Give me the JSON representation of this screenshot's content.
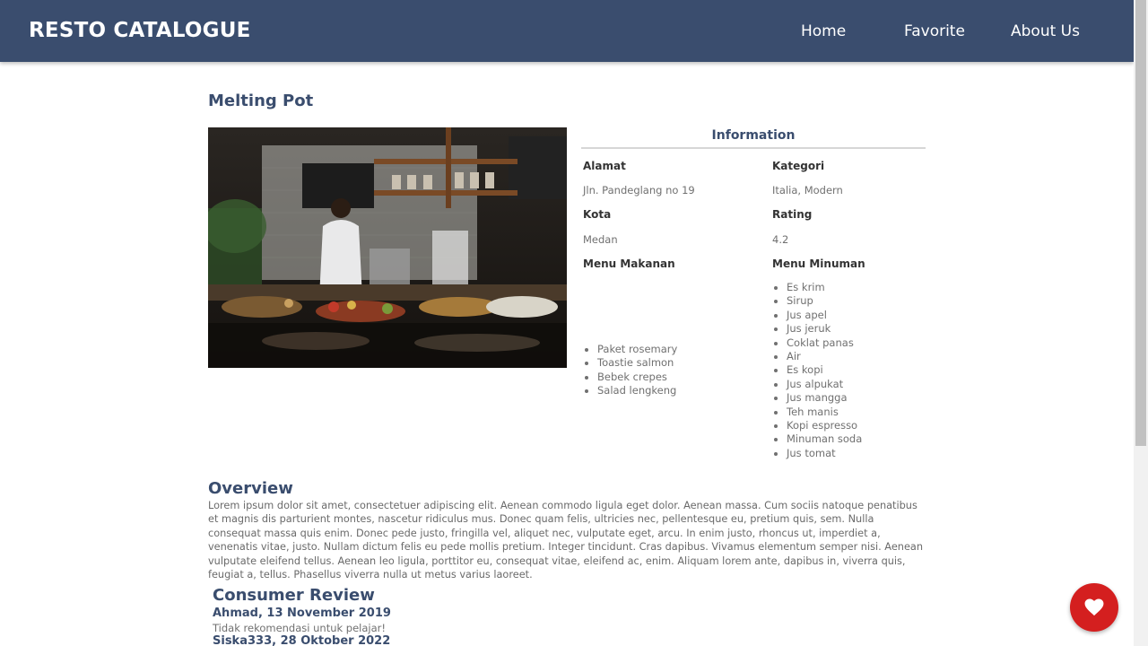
{
  "header": {
    "brand": "RESTO CATALOGUE",
    "nav": [
      "Home",
      "Favorite",
      "About Us"
    ]
  },
  "restaurant": {
    "name": "Melting Pot",
    "info_heading": "Information",
    "alamat_label": "Alamat",
    "alamat": "Jln. Pandeglang no 19",
    "kategori_label": "Kategori",
    "kategori": "Italia, Modern",
    "kota_label": "Kota",
    "kota": "Medan",
    "rating_label": "Rating",
    "rating": "4.2",
    "menu_makanan_label": "Menu Makanan",
    "menu_makanan": [
      "Paket rosemary",
      "Toastie salmon",
      "Bebek crepes",
      "Salad lengkeng"
    ],
    "menu_minuman_label": "Menu Minuman",
    "menu_minuman": [
      "Es krim",
      "Sirup",
      "Jus apel",
      "Jus jeruk",
      "Coklat panas",
      "Air",
      "Es kopi",
      "Jus alpukat",
      "Jus mangga",
      "Teh manis",
      "Kopi espresso",
      "Minuman soda",
      "Jus tomat"
    ]
  },
  "overview": {
    "title": "Overview",
    "text": "Lorem ipsum dolor sit amet, consectetuer adipiscing elit. Aenean commodo ligula eget dolor. Aenean massa. Cum sociis natoque penatibus et magnis dis parturient montes, nascetur ridiculus mus. Donec quam felis, ultricies nec, pellentesque eu, pretium quis, sem. Nulla consequat massa quis enim. Donec pede justo, fringilla vel, aliquet nec, vulputate eget, arcu. In enim justo, rhoncus ut, imperdiet a, venenatis vitae, justo. Nullam dictum felis eu pede mollis pretium. Integer tincidunt. Cras dapibus. Vivamus elementum semper nisi. Aenean vulputate eleifend tellus. Aenean leo ligula, porttitor eu, consequat vitae, eleifend ac, enim. Aliquam lorem ante, dapibus in, viverra quis, feugiat a, tellus. Phasellus viverra nulla ut metus varius laoreet."
  },
  "reviews": {
    "title": "Consumer Review",
    "items": [
      {
        "name": "Ahmad, 13 November 2019",
        "text": "Tidak rekomendasi untuk pelajar!"
      },
      {
        "name": "Siska333, 28 Oktober 2022",
        "text": ""
      }
    ]
  },
  "colors": {
    "header": "#3a4d6e",
    "favorite_button": "#d41f1f"
  },
  "icons": {
    "favorite": "heart-icon"
  }
}
